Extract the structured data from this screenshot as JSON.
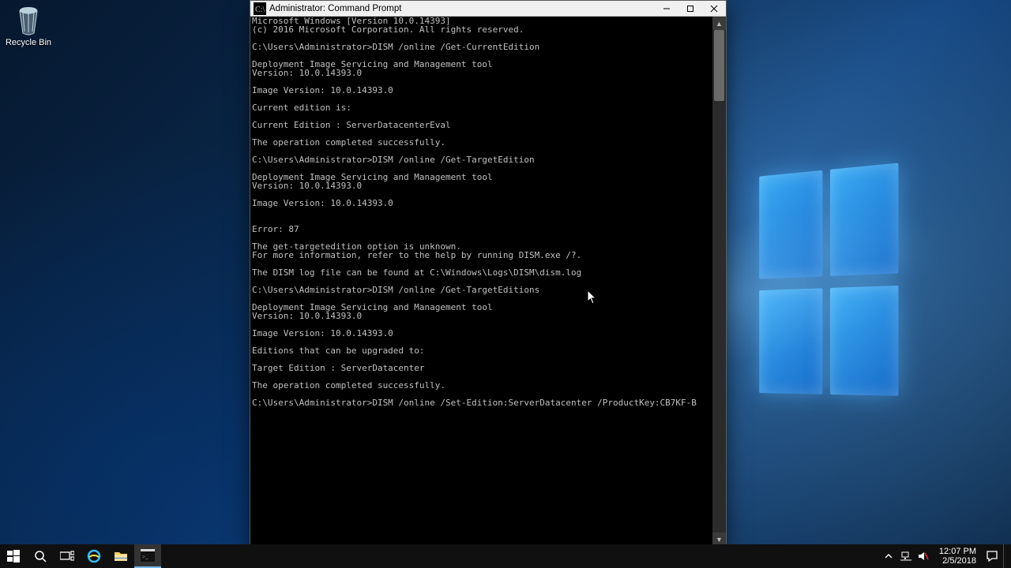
{
  "desktop": {
    "icons": {
      "recycle_bin": "Recycle Bin"
    }
  },
  "window": {
    "title": "Administrator: Command Prompt",
    "buttons": {
      "min": "–",
      "max": "□",
      "close": "✕"
    }
  },
  "console": {
    "lines": [
      "Microsoft Windows [Version 10.0.14393]",
      "(c) 2016 Microsoft Corporation. All rights reserved.",
      "",
      "C:\\Users\\Administrator>DISM /online /Get-CurrentEdition",
      "",
      "Deployment Image Servicing and Management tool",
      "Version: 10.0.14393.0",
      "",
      "Image Version: 10.0.14393.0",
      "",
      "Current edition is:",
      "",
      "Current Edition : ServerDatacenterEval",
      "",
      "The operation completed successfully.",
      "",
      "C:\\Users\\Administrator>DISM /online /Get-TargetEdition",
      "",
      "Deployment Image Servicing and Management tool",
      "Version: 10.0.14393.0",
      "",
      "Image Version: 10.0.14393.0",
      "",
      "",
      "Error: 87",
      "",
      "The get-targetedition option is unknown.",
      "For more information, refer to the help by running DISM.exe /?.",
      "",
      "The DISM log file can be found at C:\\Windows\\Logs\\DISM\\dism.log",
      "",
      "C:\\Users\\Administrator>DISM /online /Get-TargetEditions",
      "",
      "Deployment Image Servicing and Management tool",
      "Version: 10.0.14393.0",
      "",
      "Image Version: 10.0.14393.0",
      "",
      "Editions that can be upgraded to:",
      "",
      "Target Edition : ServerDatacenter",
      "",
      "The operation completed successfully.",
      "",
      "C:\\Users\\Administrator>DISM /online /Set-Edition:ServerDatacenter /ProductKey:CB7KF-B"
    ]
  },
  "taskbar": {
    "clock_time": "12:07 PM",
    "clock_date": "2/5/2018"
  }
}
